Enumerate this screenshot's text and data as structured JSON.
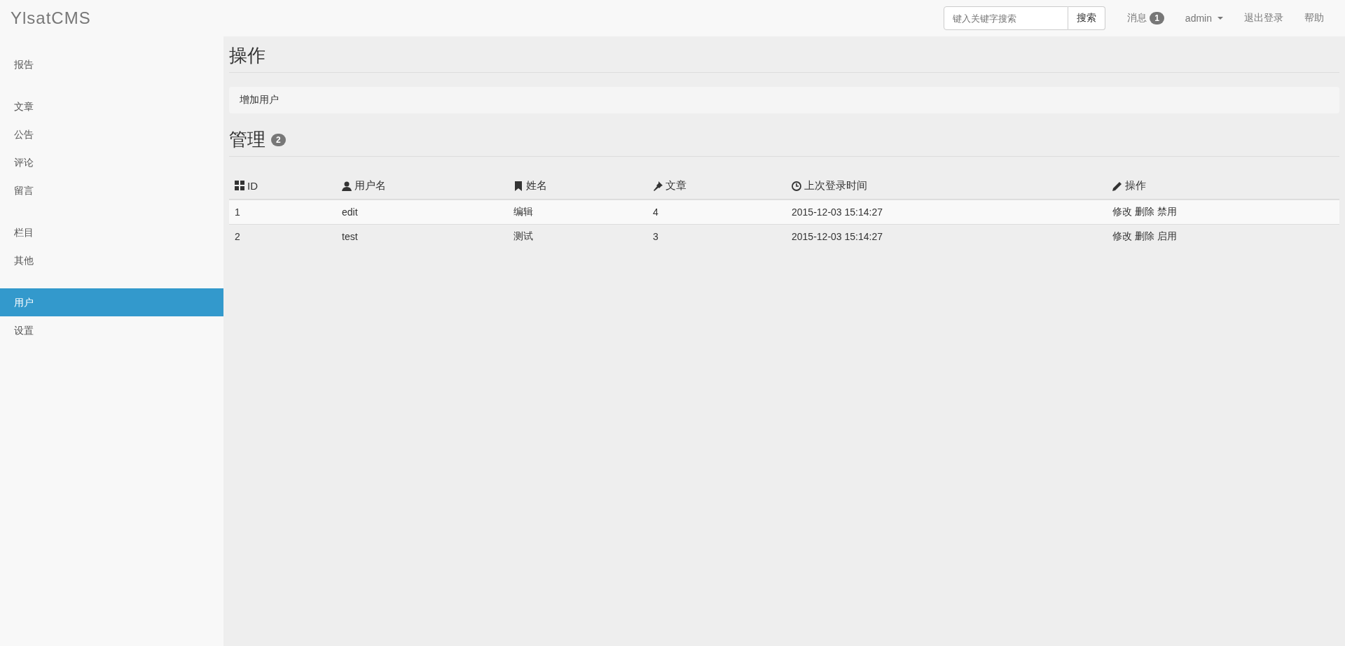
{
  "navbar": {
    "logo": "YlsatCMS",
    "search": {
      "placeholder": "键入关键字搜索",
      "button": "搜索"
    },
    "links": [
      {
        "label": "消息",
        "badge": "1",
        "kind": "plain"
      },
      {
        "label": "admin",
        "kind": "dropdown"
      },
      {
        "label": "退出登录",
        "kind": "plain"
      },
      {
        "label": "帮助",
        "kind": "plain"
      }
    ]
  },
  "sidebar": {
    "groups": [
      [
        {
          "label": "报告",
          "selected": false
        }
      ],
      [
        {
          "label": "文章",
          "selected": false
        },
        {
          "label": "公告",
          "selected": false
        },
        {
          "label": "评论",
          "selected": false
        },
        {
          "label": "留言",
          "selected": false
        }
      ],
      [
        {
          "label": "栏目",
          "selected": false
        },
        {
          "label": "其他",
          "selected": false
        }
      ],
      [
        {
          "label": "用户",
          "selected": true
        },
        {
          "label": "设置",
          "selected": false
        }
      ]
    ]
  },
  "operations": {
    "title": "操作",
    "actions": [
      "增加用户"
    ]
  },
  "management": {
    "title": "管理",
    "count": "2",
    "table": {
      "columns": [
        "ID",
        "用户名",
        "姓名",
        "文章",
        "上次登录时间",
        "操作"
      ],
      "rows": [
        {
          "cells": [
            "1",
            "edit",
            "编辑",
            "4",
            "2015-12-03 15:14:27"
          ],
          "actions": [
            "修改",
            "删除",
            "禁用"
          ]
        },
        {
          "cells": [
            "2",
            "test",
            "测试",
            "3",
            "2015-12-03 15:14:27"
          ],
          "actions": [
            "修改",
            "删除",
            "启用"
          ]
        }
      ]
    }
  }
}
